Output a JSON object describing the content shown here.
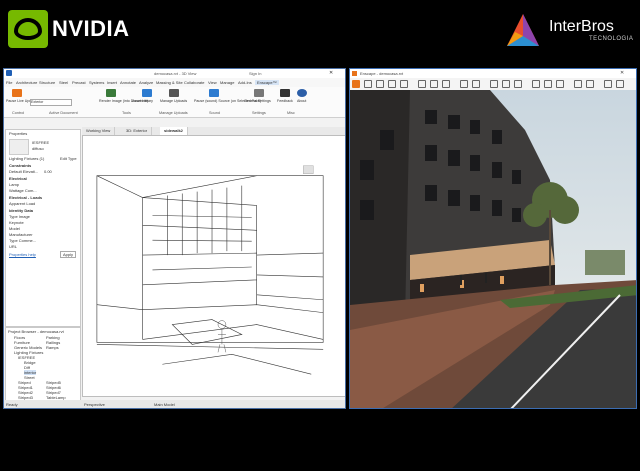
{
  "header": {
    "nvidia_text": "NVIDIA",
    "interbros_name": "InterBros",
    "interbros_sub": "TECNOLOGIA"
  },
  "revit": {
    "title": "democasa.rvt - 3D View",
    "signin": "Sign In",
    "tabs": [
      "File",
      "Architecture",
      "Structure",
      "Steel",
      "Precast",
      "Systems",
      "Insert",
      "Annotate",
      "Analyze",
      "Massing & Site",
      "Collaborate",
      "View",
      "Manage",
      "Add-Ins",
      "Enscape™"
    ],
    "ribbon": {
      "project_label": "Pause Live Updates",
      "project_value": "Exterior",
      "buttons": [
        "Render Image (into Document)",
        "Asset Library",
        "Manage Uploads",
        "Pause (sound) Source (on Selected Face)",
        "General Settings",
        "Feedback",
        "About"
      ],
      "panels": [
        "Control",
        "Active Document",
        "Tools",
        "Manage Uploads",
        "Sound",
        "Settings",
        "Misc"
      ]
    },
    "properties": {
      "header": "Properties",
      "family": "IESFREE",
      "type": "diffuso",
      "selector": "Lighting Fixtures (1)",
      "edit_type": "Edit Type",
      "rows": [
        "Constraints",
        "Default Elevati...",
        "0.00",
        "Electrical",
        "Lamp",
        "Wattage Com...",
        "Electrical - Loads",
        "Apparent Load",
        "Identity Data",
        "Type Image",
        "Keynote",
        "Model",
        "Manufacturer",
        "Type Comme...",
        "URL"
      ],
      "help": "Properties help",
      "apply": "Apply"
    },
    "browser": {
      "header": "Project Browser - democasa.rvt",
      "items": [
        "Floors",
        "Furniture",
        "Generic Models",
        "Lighting Fixtures",
        "IESFREE",
        "Bridge",
        "Diff",
        "interior",
        "Street",
        "Striped",
        "Striped1",
        "Striped2",
        "Striped3",
        "Striped4",
        "Striped5",
        "Striped6",
        "Striped7",
        "TableLamp",
        "TableLamp_T",
        "Parking",
        "Railings",
        "Ramps"
      ]
    },
    "view_tabs": [
      "Working View",
      "3D: Exterior",
      "sidewalk2"
    ],
    "view_scale": "Perspective",
    "status": "Ready",
    "main_model": "Main Model"
  },
  "enscape": {
    "title": "Enscape - democasa.rvt"
  },
  "colors": {
    "nvidia_green": "#76b900",
    "window_border": "#4a6fa5",
    "enscape_orange": "#e8731a"
  }
}
